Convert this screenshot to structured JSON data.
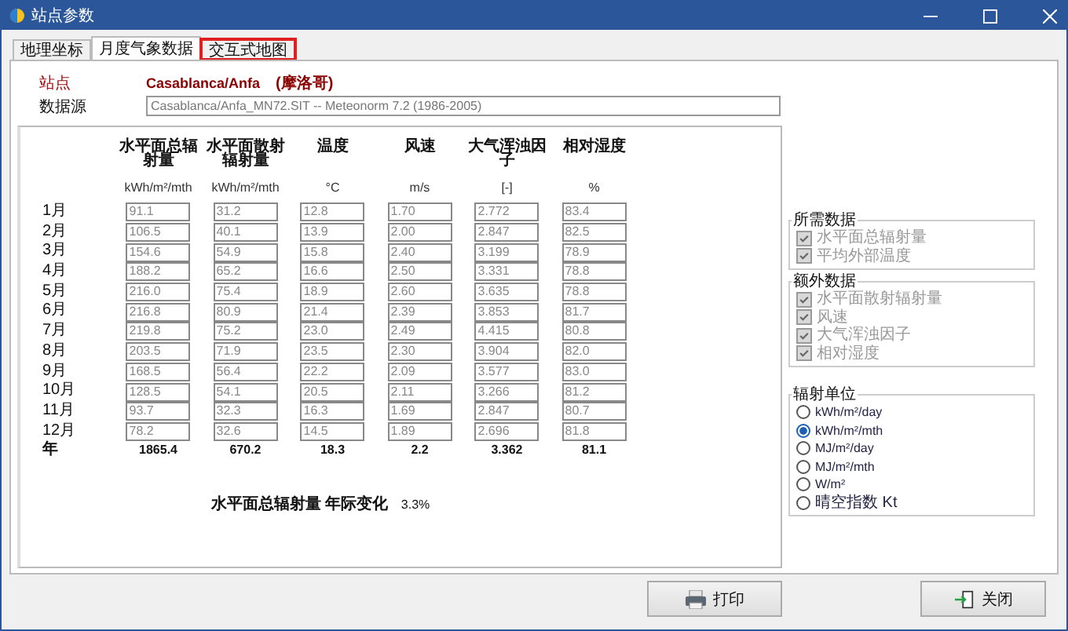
{
  "window": {
    "title": "站点参数"
  },
  "tabs": [
    {
      "label": "地理坐标",
      "selected": false,
      "highlighted": false
    },
    {
      "label": "月度气象数据",
      "selected": true,
      "highlighted": false
    },
    {
      "label": "交互式地图",
      "selected": false,
      "highlighted": true
    }
  ],
  "station": {
    "label": "站点",
    "name": "Casablanca/Anfa",
    "country": "(摩洛哥)"
  },
  "source": {
    "label": "数据源",
    "value": "Casablanca/Anfa_MN72.SIT -- Meteonorm 7.2 (1986-2005)"
  },
  "table": {
    "columns": [
      {
        "name": "水平面总辐射量",
        "unit": "kWh/m²/mth"
      },
      {
        "name": "水平面散射辐射量",
        "unit": "kWh/m²/mth"
      },
      {
        "name": "温度",
        "unit": "°C"
      },
      {
        "name": "风速",
        "unit": "m/s"
      },
      {
        "name": "大气浑浊因子",
        "unit": "[-]"
      },
      {
        "name": "相对湿度",
        "unit": "%"
      }
    ],
    "rows": [
      {
        "month": "1月",
        "values": [
          "91.1",
          "31.2",
          "12.8",
          "1.70",
          "2.772",
          "83.4"
        ]
      },
      {
        "month": "2月",
        "values": [
          "106.5",
          "40.1",
          "13.9",
          "2.00",
          "2.847",
          "82.5"
        ]
      },
      {
        "month": "3月",
        "values": [
          "154.6",
          "54.9",
          "15.8",
          "2.40",
          "3.199",
          "78.9"
        ]
      },
      {
        "month": "4月",
        "values": [
          "188.2",
          "65.2",
          "16.6",
          "2.50",
          "3.331",
          "78.8"
        ]
      },
      {
        "month": "5月",
        "values": [
          "216.0",
          "75.4",
          "18.9",
          "2.60",
          "3.635",
          "78.8"
        ]
      },
      {
        "month": "6月",
        "values": [
          "216.8",
          "80.9",
          "21.4",
          "2.39",
          "3.853",
          "81.7"
        ]
      },
      {
        "month": "7月",
        "values": [
          "219.8",
          "75.2",
          "23.0",
          "2.49",
          "4.415",
          "80.8"
        ]
      },
      {
        "month": "8月",
        "values": [
          "203.5",
          "71.9",
          "23.5",
          "2.30",
          "3.904",
          "82.0"
        ]
      },
      {
        "month": "9月",
        "values": [
          "168.5",
          "56.4",
          "22.2",
          "2.09",
          "3.577",
          "83.0"
        ]
      },
      {
        "month": "10月",
        "values": [
          "128.5",
          "54.1",
          "20.5",
          "2.11",
          "3.266",
          "81.2"
        ]
      },
      {
        "month": "11月",
        "values": [
          "93.7",
          "32.3",
          "16.3",
          "1.69",
          "2.847",
          "80.7"
        ]
      },
      {
        "month": "12月",
        "values": [
          "78.2",
          "32.6",
          "14.5",
          "1.89",
          "2.696",
          "81.8"
        ]
      }
    ],
    "total": {
      "label": "年",
      "values": [
        "1865.4",
        "670.2",
        "18.3",
        "2.2",
        "3.362",
        "81.1"
      ]
    }
  },
  "annual_variation": {
    "label": "水平面总辐射量 年际变化",
    "value": "3.3%"
  },
  "required_data": {
    "title": "所需数据",
    "items": [
      {
        "label": "水平面总辐射量",
        "checked": true,
        "disabled": true
      },
      {
        "label": "平均外部温度",
        "checked": true,
        "disabled": true
      }
    ]
  },
  "extra_data": {
    "title": "额外数据",
    "items": [
      {
        "label": "水平面散射辐射量",
        "checked": true,
        "disabled": true
      },
      {
        "label": "风速",
        "checked": true,
        "disabled": true
      },
      {
        "label": "大气浑浊因子",
        "checked": true,
        "disabled": true
      },
      {
        "label": "相对湿度",
        "checked": true,
        "disabled": true
      }
    ]
  },
  "radiation_units": {
    "title": "辐射单位",
    "options": [
      {
        "label": "kWh/m²/day",
        "selected": false
      },
      {
        "label": "kWh/m²/mth",
        "selected": true
      },
      {
        "label": "MJ/m²/day",
        "selected": false
      },
      {
        "label": "MJ/m²/mth",
        "selected": false
      },
      {
        "label": "W/m²",
        "selected": false
      },
      {
        "label": "晴空指数 Kt",
        "selected": false
      }
    ]
  },
  "buttons": [
    {
      "label": "打印",
      "kind": "print"
    },
    {
      "label": "关闭",
      "kind": "close"
    }
  ]
}
